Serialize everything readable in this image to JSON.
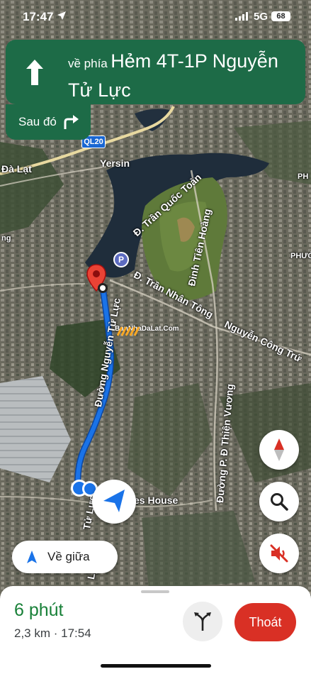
{
  "status_bar": {
    "time": "17:47",
    "network": "5G",
    "battery": "68"
  },
  "nav": {
    "toward_label": "về phía",
    "street": "Hẻm 4T-1P Nguyễn Tử Lực",
    "then_label": "Sau đó",
    "maneuver_icon": "arrow-up-icon",
    "next_maneuver_icon": "turn-right-icon"
  },
  "map": {
    "labels": {
      "road_badge": "QL20",
      "city": "Đà Lạt",
      "yersin": "Yersin",
      "tran_quoc_toan": "Đ. Trần Quốc Toản",
      "dinh_tien_hoang": "Đinh Tiên Hoàng",
      "tran_nhan_tong": "Đ. Trần Nhân Tông",
      "nguyen_cong_tru": "Nguyễn Công Trứ",
      "thien_vuong": "Đường P. Đ Thiện Vương",
      "nguyen_tu_luc": "Đường Nguyễn Tử Lực",
      "tu_luc_lower": "Tử Lực",
      "ly_lower": "Lý",
      "lates_house": "Lates House",
      "phuoc_left": "ng",
      "phuoc_right": "PHƯỚ",
      "phu_right": "PH",
      "parking": "P",
      "watermark": "BanNhaDaLat.Com"
    }
  },
  "controls": {
    "compass_icon": "compass-icon",
    "search_icon": "search-icon",
    "mute_icon": "volume-off-icon",
    "recenter_label": "Về giữa"
  },
  "trip": {
    "eta": "6 phút",
    "summary": "2,3 km · 17:54",
    "alternate_icon": "alternate-routes-icon",
    "exit_label": "Thoát"
  },
  "colors": {
    "banner_green": "#1d6b47",
    "route_blue": "#1a73e8",
    "exit_red": "#d93025",
    "eta_green": "#188038"
  }
}
